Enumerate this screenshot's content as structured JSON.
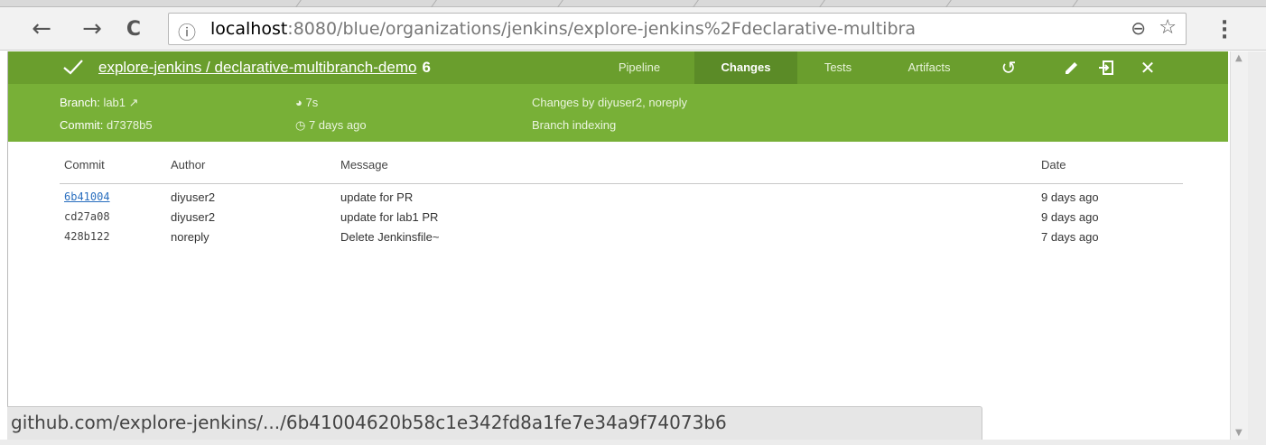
{
  "browser": {
    "back_icon": "←",
    "forward_icon": "→",
    "reload_icon": "C",
    "info_icon": "ⓘ",
    "url_host": "localhost",
    "url_rest": ":8080/blue/organizations/jenkins/explore-jenkins%2Fdeclarative-multibra",
    "zoom_icon": "⊖",
    "star_icon": "☆",
    "menu_icon": "⋮"
  },
  "run": {
    "title_link": "explore-jenkins / declarative-multibranch-demo",
    "run_number": "6",
    "status_color": "#78b037",
    "tabs": [
      {
        "label": "Pipeline"
      },
      {
        "label": "Changes"
      },
      {
        "label": "Tests"
      },
      {
        "label": "Artifacts"
      }
    ],
    "branch_label": "Branch:",
    "branch_value": "lab1",
    "commit_label": "Commit:",
    "commit_value": "d7378b5",
    "duration": "7s",
    "started": "7 days ago",
    "changes_by": "Changes by diyuser2, noreply",
    "cause": "Branch indexing"
  },
  "changes": {
    "headers": {
      "commit": "Commit",
      "author": "Author",
      "message": "Message",
      "date": "Date"
    },
    "rows": [
      {
        "commit": "6b41004",
        "author": "diyuser2",
        "message": "update for PR",
        "date": "9 days ago"
      },
      {
        "commit": "cd27a08",
        "author": "diyuser2",
        "message": "update for lab1 PR",
        "date": "9 days ago"
      },
      {
        "commit": "428b122",
        "author": "noreply",
        "message": "Delete Jenkinsfile~",
        "date": "7 days ago"
      }
    ]
  },
  "status_bar": {
    "text": "github.com/explore-jenkins/.../6b41004620b58c1e342fd8a1fe7e34a9f74073b6"
  }
}
